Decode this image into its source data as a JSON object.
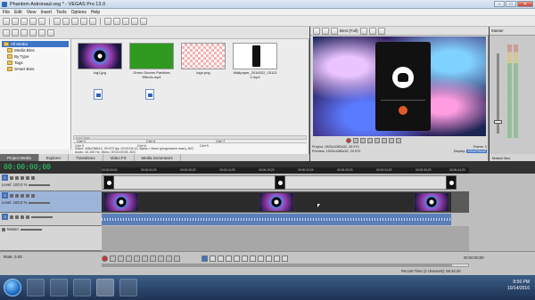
{
  "window": {
    "title": "Phantom Astronaut.veg * - VEGAS Pro 13.0"
  },
  "menu": [
    "File",
    "Edit",
    "View",
    "Insert",
    "Tools",
    "Options",
    "Help"
  ],
  "explorer": {
    "tree": [
      {
        "label": "All Media",
        "selected": true
      },
      {
        "label": "Media Bins"
      },
      {
        "label": "By Type"
      },
      {
        "label": "Tags"
      },
      {
        "label": "Smart Bins"
      }
    ],
    "media": [
      {
        "label": "lcg1.jpg",
        "thumb": "nebula"
      },
      {
        "label": "Green Screen Particles Effects.mp4",
        "thumb": "green"
      },
      {
        "label": "logo.png",
        "thumb": "checker"
      },
      {
        "label": "Wallpaper_2016022_15113 2.mp4",
        "thumb": "phone"
      }
    ],
    "shortcuts_header": "Add Tags",
    "shortcuts": [
      "Ctrl+1",
      "Ctrl+2",
      "Ctrl+3",
      "Ctrl+4",
      "Ctrl+5",
      "Ctrl+6",
      "Ctrl+7",
      "Ctrl+8",
      "Ctrl+9"
    ],
    "info_line1": "Video: 448x768x12, 29.970 fps, 00:00:04:12, Alpha = None (progressive scan), AVC",
    "info_line2": "Audio: 44,100 Hz, Mono, 00:03:29:05, AVC",
    "tabs": [
      "Project Media",
      "Explorer",
      "Transitions",
      "Video FX",
      "Media Generators"
    ]
  },
  "preview": {
    "quality": "Best (Full)",
    "project_label": "Project:",
    "project_value": "1920x1080x32, 29.970",
    "preview_label": "Preview:",
    "preview_value": "1920x1080x32, 29.970",
    "frame_label": "Frame:",
    "frame_value": "0",
    "display_label": "Display:",
    "display_value": "400x225x32"
  },
  "mixer": {
    "title": "Master",
    "tabs": "Master Bus"
  },
  "timeline": {
    "timecode": "00:00:00;00",
    "ruler": [
      "00:00:00;00",
      "00:00:04;29",
      "00:00:09;29",
      "00:00:14;29",
      "00:00:19;29",
      "00:00:24;29",
      "00:00:29;29",
      "00:00:34;29",
      "00:00:39;29",
      "00:00:44;29"
    ],
    "tracks": [
      {
        "num": "1",
        "level_label": "Level: 100.0 %"
      },
      {
        "num": "2",
        "level_label": "Level: 100.0 %"
      },
      {
        "num": "3",
        "level_label": ""
      }
    ],
    "master_label": "Master",
    "rate_label": "Rate: 0.00",
    "end_timecode": "00:00:00;00",
    "record_time": "Record Time (2 channels): 56:34:40"
  },
  "taskbar": {
    "time": "8:56 PM",
    "date": "10/14/2016"
  },
  "colors": {
    "accent": "#3d74c4",
    "timecode": "#29d36a"
  }
}
